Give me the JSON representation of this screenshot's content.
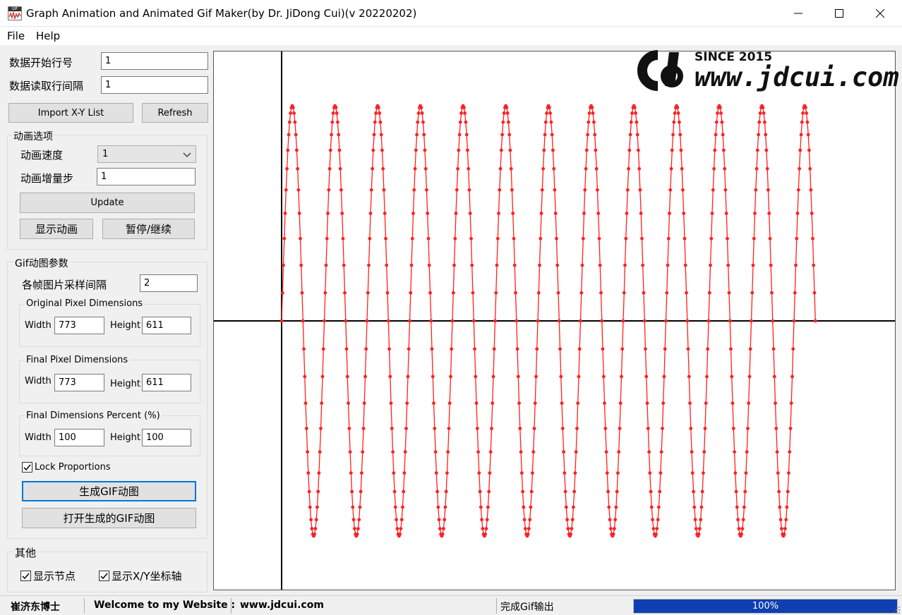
{
  "window": {
    "title": "Graph Animation and Animated Gif Maker(by Dr. JiDong Cui)(v 20220202)",
    "icon_text": "GIF"
  },
  "menu": {
    "file": "File",
    "help": "Help"
  },
  "data_params": {
    "start_row_label": "数据开始行号",
    "start_row_value": "1",
    "row_interval_label": "数据读取行间隔",
    "row_interval_value": "1",
    "import_button": "Import X-Y List",
    "refresh_button": "Refresh"
  },
  "animation_options": {
    "group_title": "动画选项",
    "speed_label": "动画速度",
    "speed_value": "1",
    "step_label": "动画增量步",
    "step_value": "1",
    "update_button": "Update",
    "show_button": "显示动画",
    "pause_button": "暂停/继续"
  },
  "gif_params": {
    "group_title": "Gif动图参数",
    "frame_interval_label": "各帧图片采样间隔",
    "frame_interval_value": "2",
    "original": {
      "title": "Original Pixel Dimensions",
      "width_label": "Width",
      "width_value": "773",
      "height_label": "Height",
      "height_value": "611"
    },
    "final": {
      "title": "Final Pixel Dimensions",
      "width_label": "Width",
      "width_value": "773",
      "height_label": "Height",
      "height_value": "611"
    },
    "percent": {
      "title": "Final Dimensions Percent (%)",
      "width_label": "Width",
      "width_value": "100",
      "height_label": "Height",
      "height_value": "100"
    },
    "lock_label": "Lock Proportions",
    "lock_checked": true,
    "generate_button": "生成GIF动图",
    "open_button": "打开生成的GIF动图"
  },
  "other": {
    "group_title": "其他",
    "show_nodes_label": "显示节点",
    "show_nodes_checked": true,
    "show_axes_label": "显示X/Y坐标轴",
    "show_axes_checked": true
  },
  "watermark": {
    "since": "SINCE 2015",
    "url": "www.jdcui.com"
  },
  "status": {
    "author": "崔济东博士",
    "welcome": "Welcome to my Website :",
    "website": "www.jdcui.com",
    "message": "完成Gif输出",
    "progress_percent": 100,
    "progress_text": "100%"
  },
  "colors": {
    "curve": "#ff2020",
    "axis": "#000000",
    "progress": "#0f3fb0"
  },
  "chart_data": {
    "type": "line",
    "title": "",
    "xlabel": "",
    "ylabel": "",
    "cycles": 12.5,
    "points_per_cycle": 48,
    "amplitude": 1,
    "show_markers": true,
    "show_axes": true,
    "grid": false
  }
}
